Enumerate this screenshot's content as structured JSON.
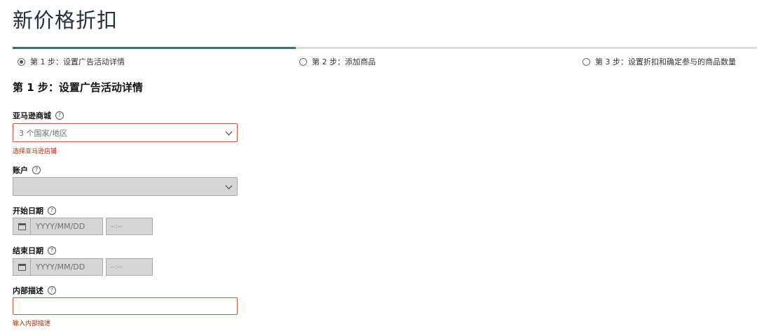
{
  "header": {
    "title": "新价格折扣"
  },
  "progress": {
    "fraction": 0.38
  },
  "steps": [
    {
      "label": "第 1 步：设置广告活动详情",
      "selected": true
    },
    {
      "label": "第 2 步：添加商品",
      "selected": false
    },
    {
      "label": "第 3 步：设置折扣和确定参与的商品数量",
      "selected": false
    }
  ],
  "section": {
    "heading": "第 1 步：设置广告活动详情"
  },
  "help_glyph": "?",
  "form": {
    "marketplace": {
      "label": "亚马逊商城",
      "value": "3 个国家/地区",
      "error": "选择亚马逊店铺"
    },
    "account": {
      "label": "账户",
      "value": ""
    },
    "start_date": {
      "label": "开始日期",
      "date_placeholder": "YYYY/MM/DD",
      "time_placeholder": "--:--"
    },
    "end_date": {
      "label": "结束日期",
      "date_placeholder": "YYYY/MM/DD",
      "time_placeholder": "--:--"
    },
    "internal_description": {
      "label": "内部描述",
      "value": "",
      "error": "输入内部描述"
    }
  },
  "colors": {
    "progress": "#3b6e80",
    "error": "#b12704",
    "error_border": "#c45b3c",
    "disabled_bg": "#d6d6d6"
  }
}
